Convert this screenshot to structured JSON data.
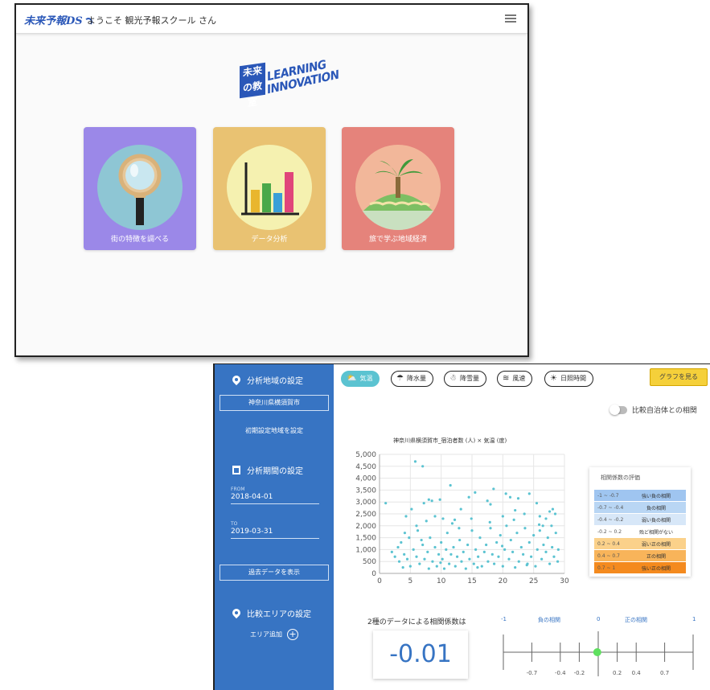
{
  "top_window": {
    "logo_text": "未来予報DS",
    "welcome": "ようこそ 観光予報スクール さん",
    "brand_left": "未来の教室",
    "brand_right": "LEARNING INNOVATION",
    "cards": [
      {
        "label": "街の特徴を調べる",
        "color": "#9b88e8"
      },
      {
        "label": "データ分析",
        "color": "#e9c272"
      },
      {
        "label": "旅で学ぶ地域経済",
        "color": "#e5837b"
      }
    ]
  },
  "sidebar": {
    "region_title": "分析地域の設定",
    "region_value": "神奈川県横須賀市",
    "initial_region_link": "初期設定地域を設定",
    "period_title": "分析期間の設定",
    "from_label": "FROM",
    "from_value": "2018-04-01",
    "to_label": "TO",
    "to_value": "2019-03-31",
    "past_data_button": "過去データを表示",
    "compare_title": "比較エリアの設定",
    "add_area": "エリア追加",
    "add_symbol": "+"
  },
  "chips": [
    {
      "label": "気温",
      "icon": "cloud-sun-icon",
      "glyph": "⛅",
      "active": true
    },
    {
      "label": "降水量",
      "icon": "umbrella-icon",
      "glyph": "☂",
      "active": false
    },
    {
      "label": "降雪量",
      "icon": "snowman-icon",
      "glyph": "☃",
      "active": false
    },
    {
      "label": "風速",
      "icon": "wind-icon",
      "glyph": "≋",
      "active": false
    },
    {
      "label": "日照時間",
      "icon": "sun-icon",
      "glyph": "☀",
      "active": false
    }
  ],
  "graph_button": "グラフを見る",
  "toggle_label": "比較自治体との相関",
  "chart_data": {
    "type": "scatter",
    "title": "神奈川県横須賀市_宿泊者数 (人) × 気温 (度)",
    "xlim": [
      0,
      30
    ],
    "ylim": [
      0,
      5000
    ],
    "xticks": [
      0,
      5,
      10,
      15,
      20,
      25,
      30
    ],
    "yticks": [
      0,
      500,
      1000,
      1500,
      2000,
      2500,
      3000,
      3500,
      4000,
      4500,
      5000
    ],
    "ytick_labels": [
      "0",
      "500",
      "1,000",
      "1,500",
      "2,000",
      "2,500",
      "3,000",
      "3,500",
      "4,000",
      "4,500",
      "5,000"
    ],
    "color": "#5bc3d1",
    "points": [
      [
        1,
        2950
      ],
      [
        5.8,
        4700
      ],
      [
        7,
        4500
      ],
      [
        4.3,
        2400
      ],
      [
        5.2,
        2700
      ],
      [
        6,
        2000
      ],
      [
        7.2,
        2950
      ],
      [
        8,
        3100
      ],
      [
        8.5,
        3050
      ],
      [
        9,
        2400
      ],
      [
        9.8,
        3100
      ],
      [
        10.3,
        2300
      ],
      [
        11.5,
        3700
      ],
      [
        12.2,
        2250
      ],
      [
        13.2,
        2700
      ],
      [
        14.5,
        3200
      ],
      [
        15.5,
        3400
      ],
      [
        17.5,
        3050
      ],
      [
        18,
        2900
      ],
      [
        18.5,
        3550
      ],
      [
        20,
        2400
      ],
      [
        20.5,
        3350
      ],
      [
        21.2,
        3200
      ],
      [
        22,
        2650
      ],
      [
        22.5,
        3150
      ],
      [
        23.5,
        2500
      ],
      [
        24.3,
        3350
      ],
      [
        25.5,
        2950
      ],
      [
        26,
        2400
      ],
      [
        27.6,
        2600
      ],
      [
        28.5,
        2500
      ],
      [
        26.5,
        2000
      ],
      [
        27,
        2300
      ],
      [
        2,
        900
      ],
      [
        2.5,
        700
      ],
      [
        3,
        1100
      ],
      [
        3.2,
        500
      ],
      [
        3.5,
        1300
      ],
      [
        4,
        800
      ],
      [
        4.5,
        600
      ],
      [
        4.8,
        1500
      ],
      [
        5,
        300
      ],
      [
        5.5,
        1000
      ],
      [
        6,
        700
      ],
      [
        6.2,
        1800
      ],
      [
        6.5,
        400
      ],
      [
        7,
        1200
      ],
      [
        7.3,
        600
      ],
      [
        7.8,
        900
      ],
      [
        8,
        200
      ],
      [
        8.2,
        1500
      ],
      [
        8.6,
        500
      ],
      [
        9,
        1100
      ],
      [
        9.3,
        300
      ],
      [
        9.6,
        800
      ],
      [
        10,
        1300
      ],
      [
        10.2,
        600
      ],
      [
        10.5,
        200
      ],
      [
        10.8,
        1000
      ],
      [
        11,
        1700
      ],
      [
        11.3,
        400
      ],
      [
        11.6,
        800
      ],
      [
        12,
        1100
      ],
      [
        12.3,
        300
      ],
      [
        12.6,
        700
      ],
      [
        13,
        1400
      ],
      [
        13.3,
        500
      ],
      [
        13.6,
        900
      ],
      [
        14,
        200
      ],
      [
        14.3,
        1200
      ],
      [
        14.6,
        600
      ],
      [
        15,
        1800
      ],
      [
        15.3,
        400
      ],
      [
        15.6,
        1000
      ],
      [
        16,
        700
      ],
      [
        16.3,
        1500
      ],
      [
        16.6,
        300
      ],
      [
        17,
        900
      ],
      [
        17.3,
        1200
      ],
      [
        17.6,
        500
      ],
      [
        18,
        1900
      ],
      [
        18.3,
        800
      ],
      [
        18.6,
        400
      ],
      [
        19,
        1300
      ],
      [
        19.3,
        700
      ],
      [
        19.6,
        1600
      ],
      [
        20,
        300
      ],
      [
        20.3,
        1000
      ],
      [
        20.6,
        2000
      ],
      [
        21,
        600
      ],
      [
        21.3,
        1400
      ],
      [
        21.6,
        900
      ],
      [
        22,
        250
      ],
      [
        22.3,
        1700
      ],
      [
        22.6,
        500
      ],
      [
        23,
        1100
      ],
      [
        23.3,
        800
      ],
      [
        23.6,
        1900
      ],
      [
        24,
        400
      ],
      [
        24.3,
        1300
      ],
      [
        24.6,
        700
      ],
      [
        25,
        1600
      ],
      [
        25.3,
        300
      ],
      [
        25.6,
        1000
      ],
      [
        26,
        1800
      ],
      [
        26.3,
        600
      ],
      [
        26.6,
        1200
      ],
      [
        27,
        900
      ],
      [
        27.3,
        1500
      ],
      [
        27.6,
        400
      ],
      [
        28,
        1100
      ],
      [
        28.3,
        700
      ],
      [
        28.6,
        1700
      ],
      [
        28.9,
        500
      ],
      [
        29,
        1000
      ],
      [
        3.8,
        250
      ],
      [
        6.8,
        1400
      ],
      [
        9.9,
        450
      ],
      [
        12.9,
        1900
      ],
      [
        15.9,
        250
      ],
      [
        19.9,
        1150
      ],
      [
        23.9,
        350
      ],
      [
        27.9,
        2000
      ],
      [
        4.1,
        1700
      ],
      [
        7.6,
        2200
      ],
      [
        11.8,
        2100
      ],
      [
        14.9,
        2300
      ],
      [
        17.9,
        2150
      ],
      [
        21.8,
        2250
      ],
      [
        25.9,
        2050
      ],
      [
        28.1,
        2700
      ]
    ]
  },
  "legend": {
    "title": "相関係数の評価",
    "rows": [
      {
        "range": "-1 ~ -0.7",
        "desc": "強い負の相関",
        "color": "#9fc5f0"
      },
      {
        "range": "-0.7 ~ -0.4",
        "desc": "負の相関",
        "color": "#b9d6f4"
      },
      {
        "range": "-0.4 ~ -0.2",
        "desc": "弱い負の相関",
        "color": "#d7e7f8"
      },
      {
        "range": "-0.2 ~ 0.2",
        "desc": "殆ど相関がない",
        "color": "#ffffff"
      },
      {
        "range": "0.2 ~ 0.4",
        "desc": "弱い正の相関",
        "color": "#fbd18a"
      },
      {
        "range": "0.4 ~ 0.7",
        "desc": "正の相関",
        "color": "#f8b45a"
      },
      {
        "range": "0.7 ~ 1",
        "desc": "強い正の相関",
        "color": "#f48a1e"
      }
    ]
  },
  "correlation": {
    "label": "2種のデータによる相関係数は",
    "value": "-0.01",
    "value_num": -0.01,
    "scale_top": {
      "min": "-1",
      "neg": "負の相関",
      "zero": "0",
      "pos": "正の相関",
      "max": "1"
    },
    "scale_ticks": [
      "-0.7",
      "-0.4",
      "-0.2",
      "0.2",
      "0.4",
      "0.7"
    ]
  }
}
